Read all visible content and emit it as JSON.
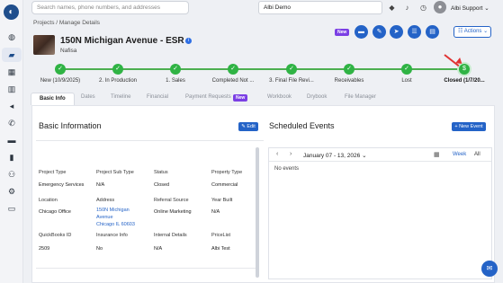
{
  "topbar": {
    "search_placeholder": "Search names, phone numbers, and addresses",
    "company": "Albi Demo",
    "user": "Albi Support",
    "user_menu_icon": "chevron-down-icon"
  },
  "breadcrumb": "Projects / Manage Details",
  "project": {
    "title": "150N Michigan Avenue - ESR",
    "subtitle": "Nafisa"
  },
  "header_actions": {
    "new_badge": "New",
    "actions_label": "Actions"
  },
  "stages": [
    {
      "label": "New (10/9/2025)",
      "state": "done"
    },
    {
      "label": "2. In Production",
      "state": "done"
    },
    {
      "label": "1. Sales",
      "state": "done"
    },
    {
      "label": "Completed Not ...",
      "state": "done"
    },
    {
      "label": "3. Final File Revi...",
      "state": "done"
    },
    {
      "label": "Receivables",
      "state": "done"
    },
    {
      "label": "Lost",
      "state": "done"
    },
    {
      "label": "Closed (1/7/20...",
      "state": "current"
    }
  ],
  "tabs": {
    "basic_info": "Basic Info",
    "dates": "Dates",
    "timeline": "Timeline",
    "financial": "Financial",
    "payment_requests": "Payment Requests",
    "payment_new": "New",
    "workbook": "Workbook",
    "drybook": "Drybook",
    "file_manager": "File Manager"
  },
  "basic_info": {
    "title": "Basic Information",
    "edit_label": "Edit",
    "fields": {
      "project_type_label": "Project Type",
      "project_type": "Emergency Services",
      "project_subtype_label": "Project Sub Type",
      "project_subtype": "N/A",
      "status_label": "Status",
      "status": "Closed",
      "property_type_label": "Property Type",
      "property_type": "Commercial",
      "location_label": "Location",
      "location": "Chicago Office",
      "address_label": "Address",
      "address_line1": "150N Michigan",
      "address_line2": "Avenue",
      "address_line3": "Chicago IL 60603",
      "referral_label": "Referral Source",
      "referral": "Online Marketing",
      "year_built_label": "Year Built",
      "year_built": "N/A",
      "quickbooks_label": "QuickBooks ID",
      "quickbooks": "2509",
      "insurance_label": "Insurance Info",
      "insurance": "No",
      "internal_label": "Internal Details",
      "internal": "N/A",
      "pricelist_label": "PriceList",
      "pricelist": "Albi Test"
    }
  },
  "events": {
    "title": "Scheduled Events",
    "new_event_label": "+ New Event",
    "range": "January 07 - 13, 2026",
    "week_label": "Week",
    "all_label": "All",
    "empty": "No events"
  },
  "colors": {
    "primary": "#2463c7",
    "stage_green": "#2fb344",
    "new_badge": "#7b3fe4",
    "arrow": "#e03333"
  }
}
